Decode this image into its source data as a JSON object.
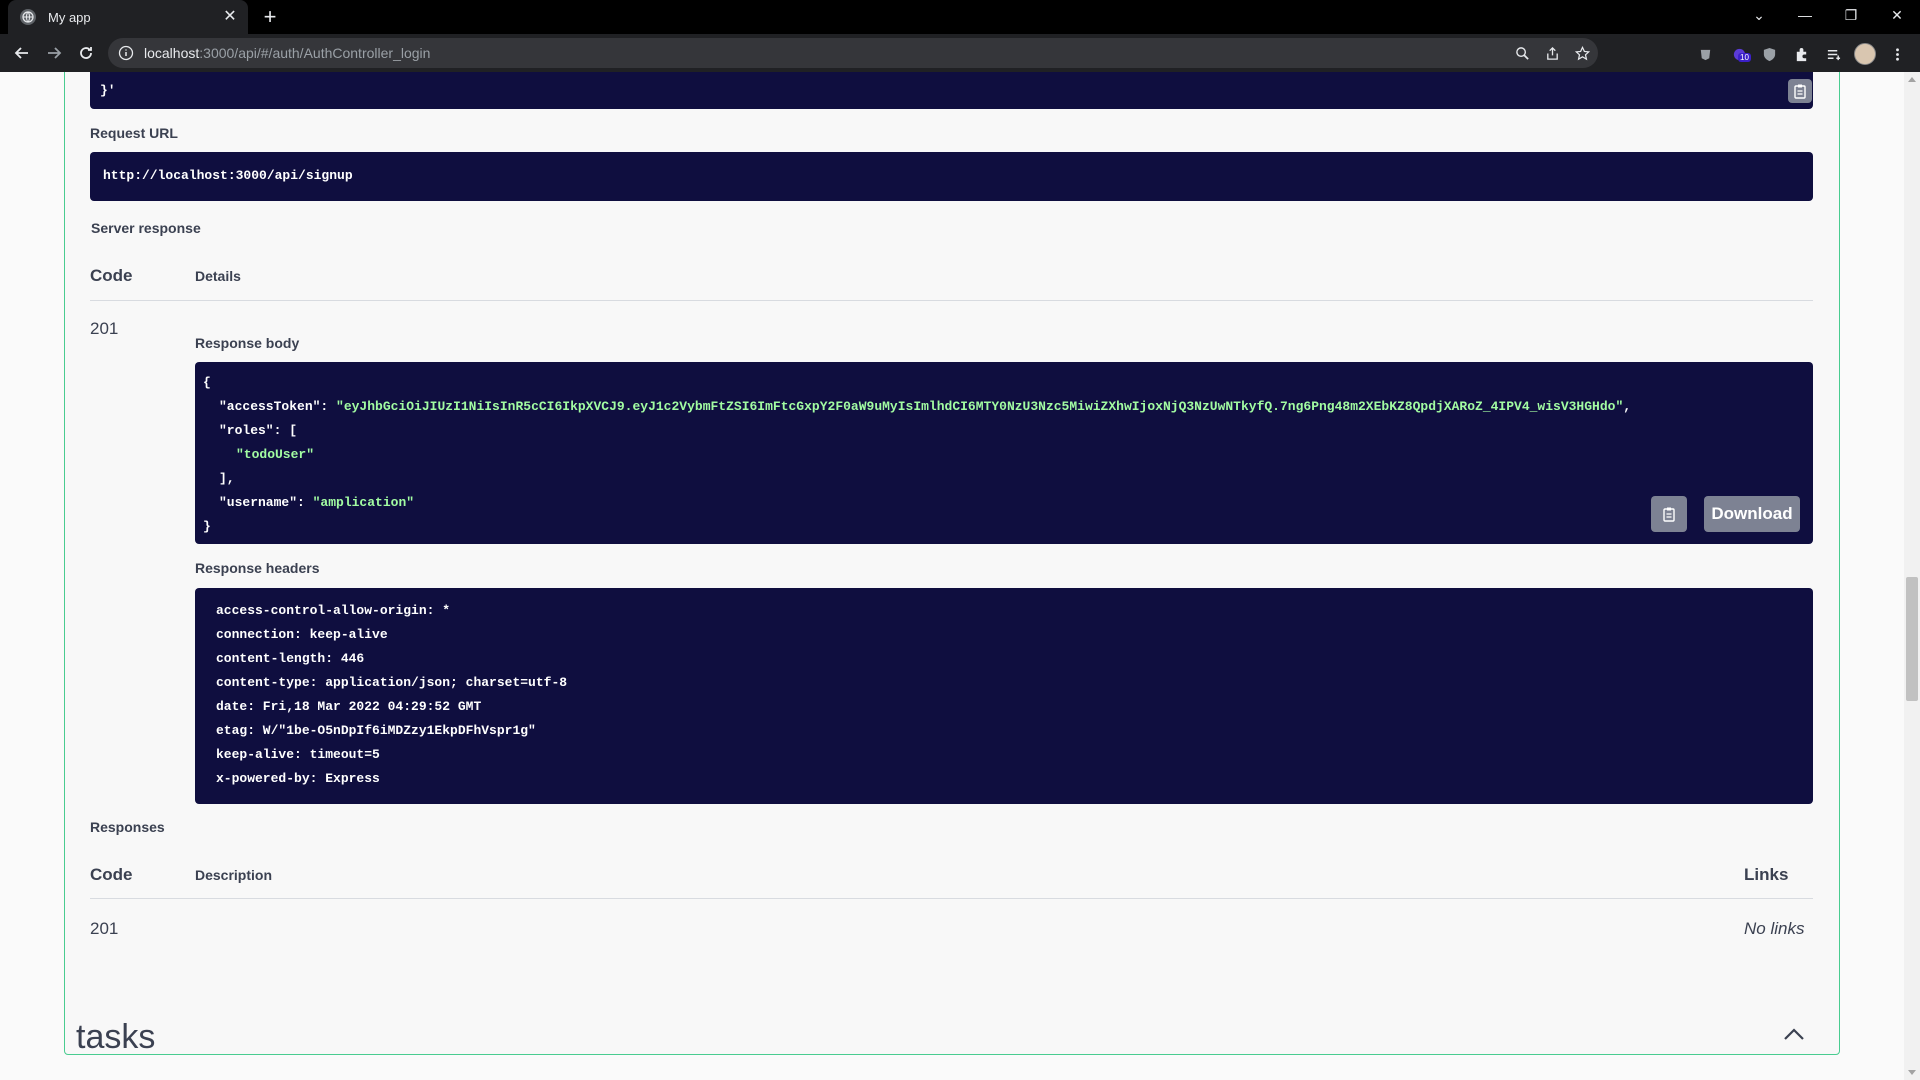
{
  "browser": {
    "tab_title": "My app",
    "new_tab": "+",
    "url_host": "localhost",
    "url_rest": ":3000/api/#/auth/AuthController_login",
    "ext_badge": "10"
  },
  "request_body_tail": "}'",
  "request_url": {
    "label": "Request URL",
    "value": "http://localhost:3000/api/signup"
  },
  "server_response": {
    "label": "Server response",
    "col_code": "Code",
    "col_details": "Details",
    "status": "201",
    "body_label": "Response body",
    "body": {
      "open": "{",
      "access_key": "\"accessToken\"",
      "access_value": "\"eyJhbGciOiJIUzI1NiIsInR5cCI6IkpXVCJ9.eyJ1c2VybmFtZSI6ImFtcGxpY2F0aW9uMyIsImlhdCI6MTY0NzU3Nzc5MiwiZXhwIjoxNjQ3NzUwNTkyfQ.7ng6Png48m2XEbKZ8QpdjXARoZ_4IPV4_wisV3HGHdo\"",
      "roles_key": "\"roles\"",
      "roles_open": "[",
      "role_0": "\"todoUser\"",
      "roles_close": "],",
      "username_key": "\"username\"",
      "username_value": "\"amplication\"",
      "close": "}"
    },
    "download_label": "Download",
    "headers_label": "Response headers",
    "headers": [
      "access-control-allow-origin: *",
      "connection: keep-alive",
      "content-length: 446",
      "content-type: application/json; charset=utf-8",
      "date: Fri,18 Mar 2022 04:29:52 GMT",
      "etag: W/\"1be-O5nDpIf6iMDZzy1EkpDFhVspr1g\"",
      "keep-alive: timeout=5",
      "x-powered-by: Express"
    ]
  },
  "responses": {
    "label": "Responses",
    "col_code": "Code",
    "col_description": "Description",
    "col_links": "Links",
    "code": "201",
    "links": "No links"
  },
  "section": {
    "title": "tasks"
  }
}
